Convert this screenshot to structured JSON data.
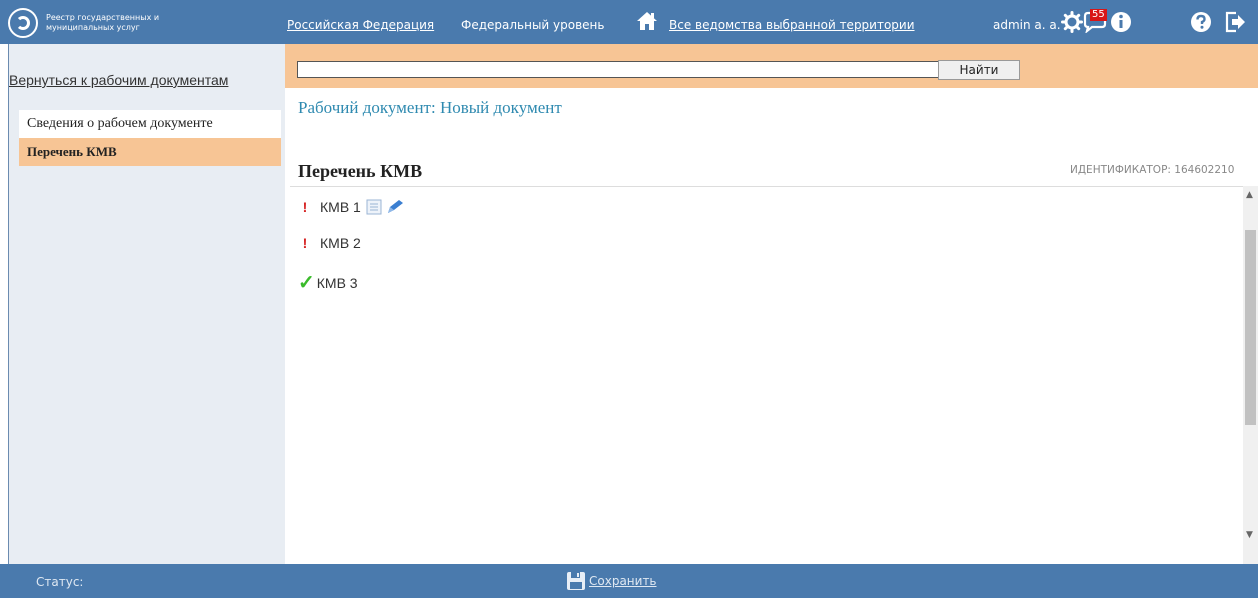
{
  "header": {
    "logo_line1": "Реестр государственных и",
    "logo_line2": "муниципальных услуг",
    "territory": "Российская Федерация",
    "level": "Федеральный уровень",
    "agencies": "Все ведомства выбранной территории",
    "user": "admin a. a.",
    "notifications_count": "55"
  },
  "sidebar": {
    "back_link": "Вернуться к рабочим документам",
    "items": [
      {
        "label": "Сведения о рабочем документе",
        "active": false
      },
      {
        "label": "Перечень КМВ",
        "active": true
      }
    ]
  },
  "search": {
    "value": "",
    "placeholder": "",
    "button": "Найти"
  },
  "main": {
    "doc_title": "Рабочий документ: Новый документ",
    "section_title": "Перечень КМВ",
    "identifier": "ИДЕНТИФИКАТОР: 164602210",
    "items": [
      {
        "label": "КМВ 1",
        "status": "warning"
      },
      {
        "label": "КМВ 2",
        "status": "warning"
      },
      {
        "label": "КМВ 3",
        "status": "ok"
      }
    ]
  },
  "footer": {
    "status_label": "Статус:",
    "save_label": "Сохранить"
  },
  "colors": {
    "header_bg": "#4a7aad",
    "accent_orange": "#f7c595",
    "title_blue": "#2f8ab0",
    "warning_red": "#d62323",
    "ok_green": "#3bbb2c"
  }
}
